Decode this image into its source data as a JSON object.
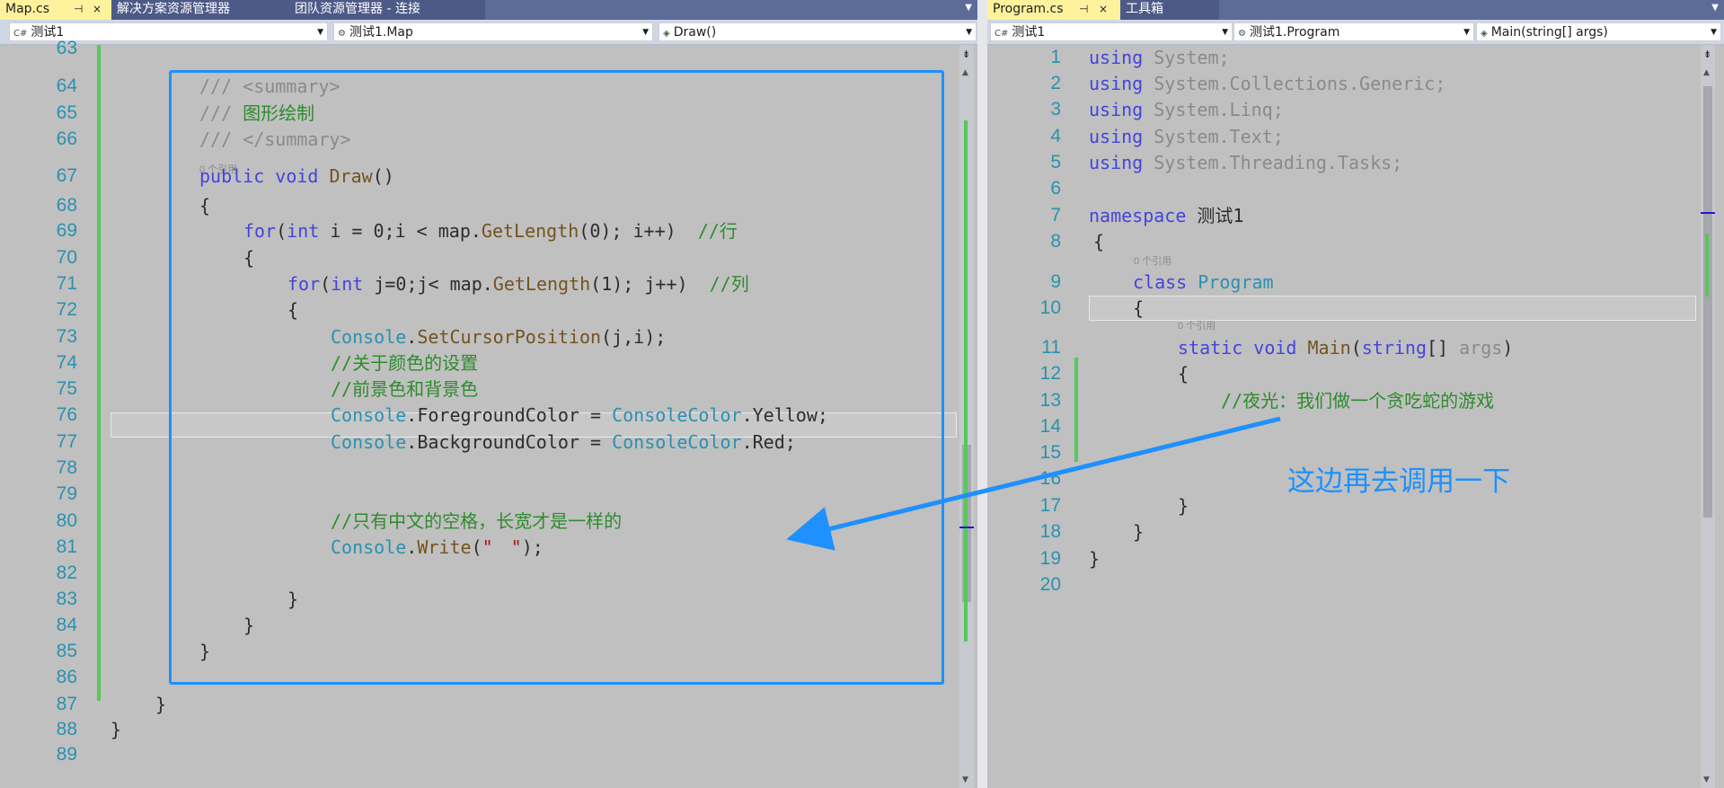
{
  "left": {
    "tabs": [
      {
        "label": "Map.cs",
        "pin": "⊣",
        "close": "×",
        "active": true
      },
      {
        "label": "解决方案资源管理器",
        "active": false
      },
      {
        "label": "团队资源管理器 - 连接",
        "active": false
      }
    ],
    "nav": {
      "project": "测试1",
      "class": "测试1.Map",
      "member": "Draw()"
    },
    "lines": [
      {
        "n": "63",
        "parts": []
      },
      {
        "n": "64",
        "parts": [
          [
            "cmg",
            "/// <summary>"
          ]
        ]
      },
      {
        "n": "65",
        "parts": [
          [
            "cmg",
            "/// "
          ],
          [
            "cm",
            "图形绘制"
          ]
        ]
      },
      {
        "n": "66",
        "parts": [
          [
            "cmg",
            "/// </summary>"
          ]
        ]
      },
      {
        "n": "67",
        "parts": [
          [
            "kw",
            "public"
          ],
          [
            "tx",
            " "
          ],
          [
            "kw",
            "void"
          ],
          [
            "tx",
            " "
          ],
          [
            "fn",
            "Draw"
          ],
          [
            "tx",
            "()"
          ]
        ]
      },
      {
        "n": "68",
        "parts": [
          [
            "tx",
            "{"
          ]
        ]
      },
      {
        "n": "69",
        "parts": [
          [
            "kw",
            "for"
          ],
          [
            "tx",
            "("
          ],
          [
            "kw",
            "int"
          ],
          [
            "tx",
            " i = 0;i < map."
          ],
          [
            "fn",
            "GetLength"
          ],
          [
            "tx",
            "(0); i++)  "
          ],
          [
            "cm",
            "//行"
          ]
        ]
      },
      {
        "n": "70",
        "parts": [
          [
            "tx",
            "{"
          ]
        ]
      },
      {
        "n": "71",
        "parts": [
          [
            "kw",
            "for"
          ],
          [
            "tx",
            "("
          ],
          [
            "kw",
            "int"
          ],
          [
            "tx",
            " j=0;j< map."
          ],
          [
            "fn",
            "GetLength"
          ],
          [
            "tx",
            "(1); j++)  "
          ],
          [
            "cm",
            "//列"
          ]
        ]
      },
      {
        "n": "72",
        "parts": [
          [
            "tx",
            "{"
          ]
        ]
      },
      {
        "n": "73",
        "parts": [
          [
            "ty",
            "Console"
          ],
          [
            "tx",
            "."
          ],
          [
            "fn",
            "SetCursorPosition"
          ],
          [
            "tx",
            "(j,i);"
          ]
        ]
      },
      {
        "n": "74",
        "parts": [
          [
            "cm",
            "//关于颜色的设置"
          ]
        ]
      },
      {
        "n": "75",
        "parts": [
          [
            "cm",
            "//前景色和背景色"
          ]
        ]
      },
      {
        "n": "76",
        "parts": [
          [
            "ty",
            "Console"
          ],
          [
            "tx",
            ".ForegroundColor = "
          ],
          [
            "ty",
            "ConsoleColor"
          ],
          [
            "tx",
            ".Yellow;"
          ]
        ]
      },
      {
        "n": "77",
        "parts": [
          [
            "ty",
            "Console"
          ],
          [
            "tx",
            ".BackgroundColor = "
          ],
          [
            "ty",
            "ConsoleColor"
          ],
          [
            "tx",
            ".Red;"
          ]
        ]
      },
      {
        "n": "78",
        "parts": []
      },
      {
        "n": "79",
        "parts": []
      },
      {
        "n": "80",
        "parts": [
          [
            "cm",
            "//只有中文的空格，长宽才是一样的"
          ]
        ]
      },
      {
        "n": "81",
        "parts": [
          [
            "ty",
            "Console"
          ],
          [
            "tx",
            "."
          ],
          [
            "fn",
            "Write"
          ],
          [
            "tx",
            "("
          ],
          [
            "st",
            "\"　\""
          ],
          [
            "tx",
            ");"
          ]
        ]
      },
      {
        "n": "82",
        "parts": []
      },
      {
        "n": "83",
        "parts": [
          [
            "tx",
            "}"
          ]
        ]
      },
      {
        "n": "84",
        "parts": [
          [
            "tx",
            "}"
          ]
        ]
      },
      {
        "n": "85",
        "parts": [
          [
            "tx",
            "}"
          ]
        ]
      },
      {
        "n": "86",
        "parts": []
      },
      {
        "n": "87",
        "parts": [
          [
            "tx",
            "}"
          ]
        ]
      },
      {
        "n": "88",
        "parts": [
          [
            "tx",
            "}"
          ]
        ]
      },
      {
        "n": "89",
        "parts": []
      }
    ],
    "ref_label": "0 个引用"
  },
  "right": {
    "tabs": [
      {
        "label": "Program.cs",
        "pin": "⊣",
        "close": "×",
        "active": true
      },
      {
        "label": "工具箱",
        "active": false
      }
    ],
    "nav": {
      "project": "测试1",
      "class": "测试1.Program",
      "member": "Main(string[] args)"
    },
    "lines": [
      {
        "n": "1",
        "parts": [
          [
            "kw",
            "using"
          ],
          [
            "cmg",
            " System;"
          ]
        ]
      },
      {
        "n": "2",
        "parts": [
          [
            "kw",
            "using"
          ],
          [
            "cmg",
            " System.Collections.Generic;"
          ]
        ]
      },
      {
        "n": "3",
        "parts": [
          [
            "kw",
            "using"
          ],
          [
            "cmg",
            " System.Linq;"
          ]
        ]
      },
      {
        "n": "4",
        "parts": [
          [
            "kw",
            "using"
          ],
          [
            "cmg",
            " System.Text;"
          ]
        ]
      },
      {
        "n": "5",
        "parts": [
          [
            "kw",
            "using"
          ],
          [
            "cmg",
            " System.Threading.Tasks;"
          ]
        ]
      },
      {
        "n": "6",
        "parts": []
      },
      {
        "n": "7",
        "parts": [
          [
            "kw",
            "namespace"
          ],
          [
            "tx",
            " 测试1"
          ]
        ]
      },
      {
        "n": "8",
        "parts": [
          [
            "tx",
            "{"
          ]
        ]
      },
      {
        "n": "9",
        "parts": [
          [
            "kw",
            "class"
          ],
          [
            "tx",
            " "
          ],
          [
            "ty",
            "Program"
          ]
        ]
      },
      {
        "n": "10",
        "parts": [
          [
            "tx",
            "{"
          ]
        ]
      },
      {
        "n": "11",
        "parts": [
          [
            "kw",
            "static"
          ],
          [
            "tx",
            " "
          ],
          [
            "kw",
            "void"
          ],
          [
            "tx",
            " "
          ],
          [
            "fn",
            "Main"
          ],
          [
            "tx",
            "("
          ],
          [
            "kw",
            "string"
          ],
          [
            "tx",
            "[] "
          ],
          [
            "cmg",
            "args"
          ],
          [
            "tx",
            ")"
          ]
        ]
      },
      {
        "n": "12",
        "parts": [
          [
            "tx",
            "{"
          ]
        ]
      },
      {
        "n": "13",
        "parts": [
          [
            "cm",
            "//夜光：我们做一个贪吃蛇的游戏"
          ]
        ]
      },
      {
        "n": "14",
        "parts": []
      },
      {
        "n": "15",
        "parts": []
      },
      {
        "n": "16",
        "parts": []
      },
      {
        "n": "17",
        "parts": [
          [
            "tx",
            "}"
          ]
        ]
      },
      {
        "n": "18",
        "parts": [
          [
            "tx",
            "}"
          ]
        ]
      },
      {
        "n": "19",
        "parts": [
          [
            "tx",
            "}"
          ]
        ]
      },
      {
        "n": "20",
        "parts": []
      }
    ],
    "ref_label": "0 个引用"
  },
  "annotation": {
    "text": "这边再去调用一下",
    "color": "#1e90ff"
  },
  "colors": {
    "keyword": "#4444dd",
    "type": "#2b91af",
    "comment": "#2e8b2e",
    "change_bar": "#58c85a",
    "tab_active": "#fff29d",
    "tabbar": "#5d6b99"
  }
}
